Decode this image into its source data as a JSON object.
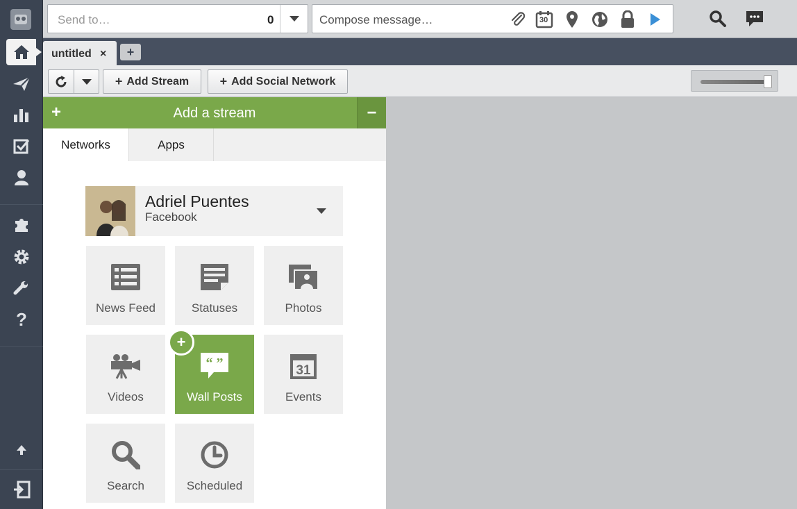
{
  "colors": {
    "accent": "#7aa84a",
    "rail": "#3b4452"
  },
  "rail": {
    "items": [
      {
        "name": "home-icon"
      },
      {
        "name": "send-icon"
      },
      {
        "name": "analytics-icon"
      },
      {
        "name": "assignments-icon"
      },
      {
        "name": "contacts-icon"
      },
      {
        "name": "apps-icon"
      },
      {
        "name": "settings-icon"
      },
      {
        "name": "tools-icon"
      },
      {
        "name": "help-icon"
      },
      {
        "name": "upload-icon"
      },
      {
        "name": "logout-icon"
      }
    ]
  },
  "topbar": {
    "send_to_placeholder": "Send to…",
    "send_to_count": "0",
    "compose_placeholder": "Compose message…",
    "calendar_day": "30"
  },
  "tabs": {
    "current": "untitled",
    "close": "×",
    "add": "+"
  },
  "toolbar": {
    "add_stream": "Add Stream",
    "add_social_network": "Add Social Network",
    "zoom_level": 1.0
  },
  "panel": {
    "title": "Add a stream",
    "tabs": [
      "Networks",
      "Apps"
    ],
    "account": {
      "name": "Adriel Puentes",
      "network": "Facebook"
    },
    "tiles": [
      {
        "label": "News Feed",
        "icon": "news-feed-icon"
      },
      {
        "label": "Statuses",
        "icon": "statuses-icon"
      },
      {
        "label": "Photos",
        "icon": "photos-icon"
      },
      {
        "label": "Videos",
        "icon": "videos-icon"
      },
      {
        "label": "Wall Posts",
        "icon": "wall-posts-icon"
      },
      {
        "label": "Events",
        "icon": "events-icon"
      },
      {
        "label": "Search",
        "icon": "search-icon"
      },
      {
        "label": "Scheduled",
        "icon": "scheduled-icon"
      }
    ],
    "events_day": "31"
  }
}
